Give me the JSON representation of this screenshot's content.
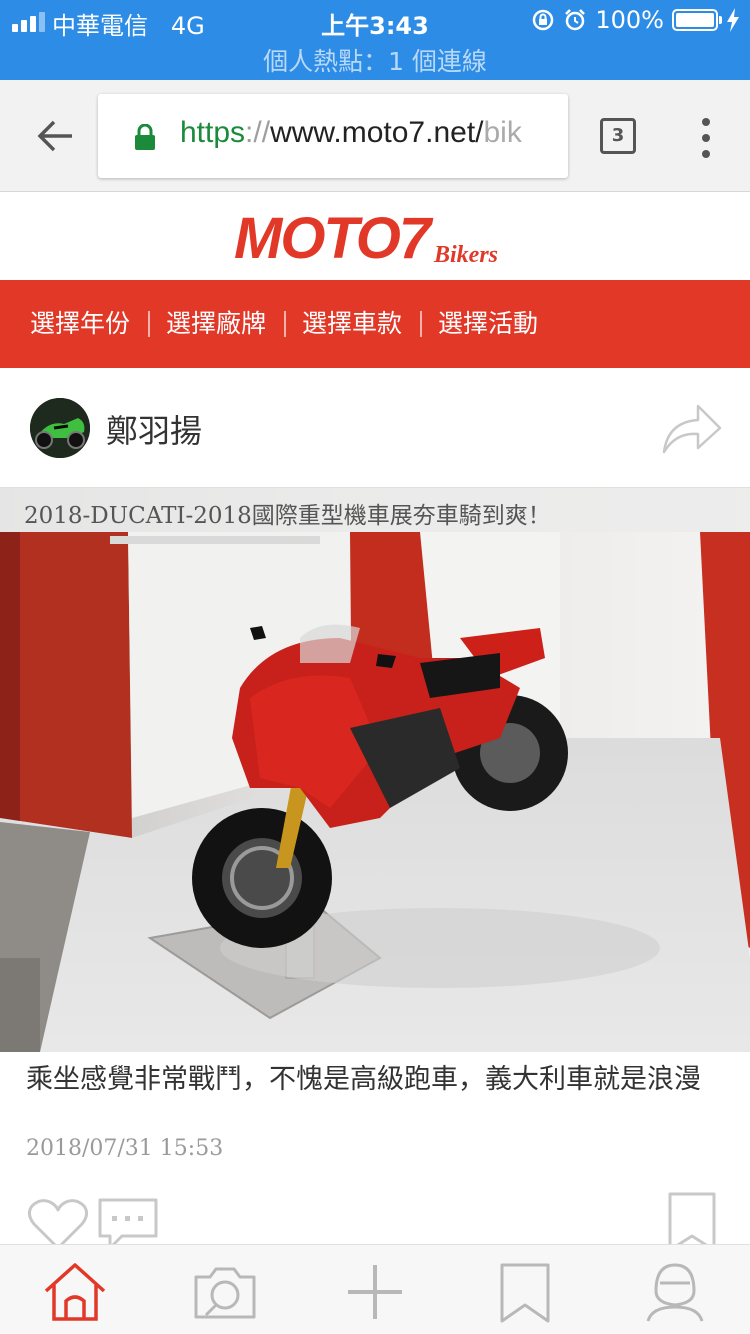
{
  "status_bar": {
    "carrier": "中華電信",
    "network": "4G",
    "time": "上午3:43",
    "battery": "100%",
    "hotspot": "個人熱點：1 個連線"
  },
  "browser": {
    "url_scheme": "https",
    "url_sep": "://",
    "url_host": "www.moto7.net/",
    "url_rest": "bik",
    "tab_count": "3"
  },
  "site": {
    "logo_text": "MOTO7",
    "logo_sub": "Bikers",
    "brand_color": "#e13828"
  },
  "nav": {
    "items": [
      {
        "label": "選擇年份"
      },
      {
        "label": "選擇廠牌"
      },
      {
        "label": "選擇車款"
      },
      {
        "label": "選擇活動"
      }
    ]
  },
  "post": {
    "author": "鄭羽揚",
    "photo_caption": "2018-DUCATI-2018國際重型機車展夯車騎到爽！",
    "text": "乘坐感覺非常戰鬥，不愧是高級跑車，義大利車就是浪漫",
    "date": "2018/07/31 15:53"
  },
  "icons": {
    "share": "share-icon",
    "like": "heart-icon",
    "comment": "comment-icon",
    "bookmark": "bookmark-icon"
  },
  "tabbar": {
    "items": [
      {
        "icon": "home-icon",
        "active": true
      },
      {
        "icon": "camera-icon",
        "active": false
      },
      {
        "icon": "plus-icon",
        "active": false
      },
      {
        "icon": "bookmark-icon",
        "active": false
      },
      {
        "icon": "profile-icon",
        "active": false
      }
    ]
  }
}
